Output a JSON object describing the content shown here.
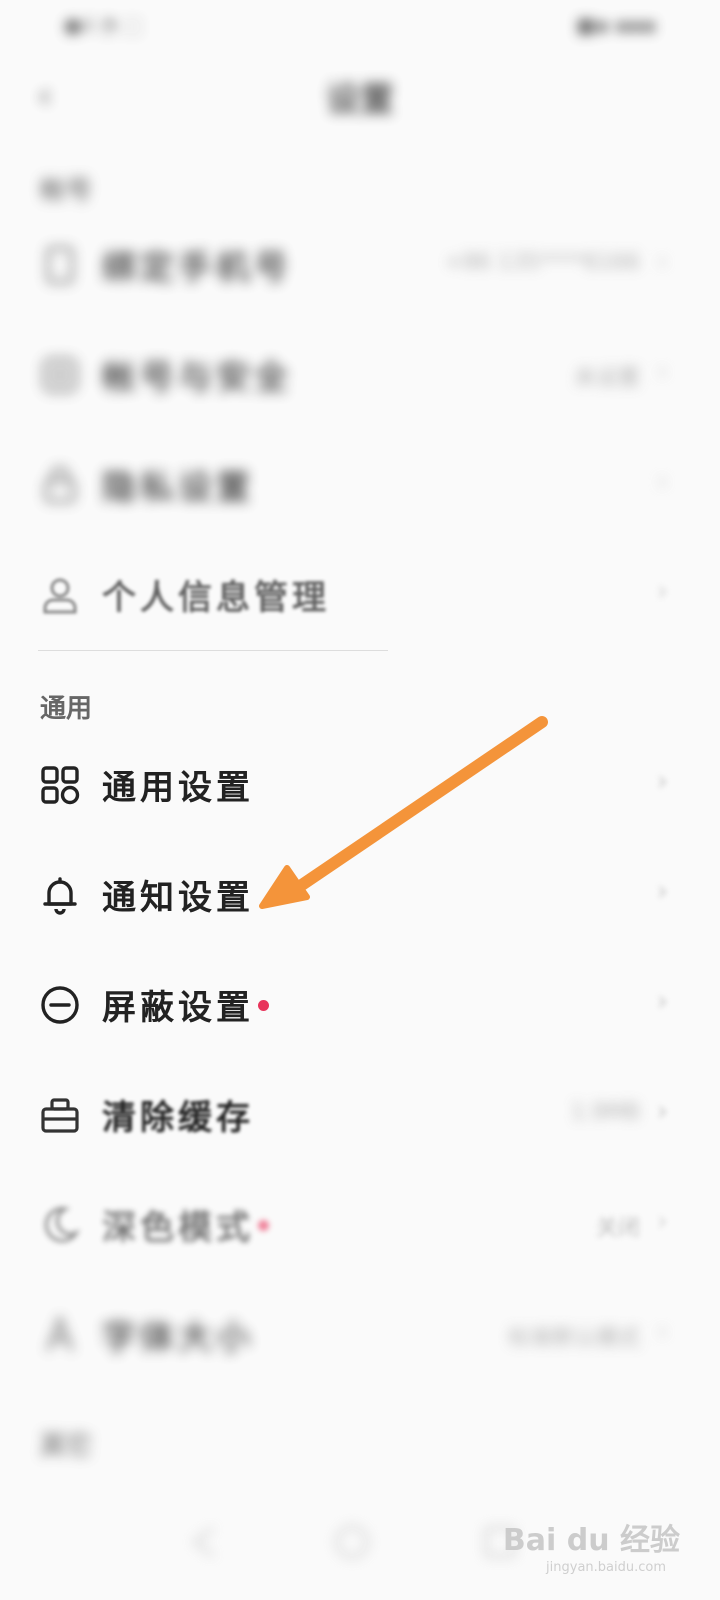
{
  "status_bar": {
    "left": "●ıl ◔ ⬚",
    "right": "■▪ ▪▪▪"
  },
  "nav": {
    "title": "设置"
  },
  "sections": {
    "account": "帐号",
    "general": "通用",
    "other": "其它"
  },
  "account_rows": [
    {
      "label": "绑定手机号",
      "value": "+86 135****6166",
      "icon": "phone-icon"
    },
    {
      "label": "帐号与安全",
      "value": "未设置",
      "icon": "security-icon"
    },
    {
      "label": "隐私设置",
      "value": "",
      "icon": "lock-icon"
    },
    {
      "label": "个人信息管理",
      "value": "",
      "icon": "person-icon"
    }
  ],
  "general_rows": [
    {
      "label": "通用设置",
      "value": "",
      "icon": "grid-icon"
    },
    {
      "label": "通知设置",
      "value": "",
      "icon": "bell-icon"
    },
    {
      "label": "屏蔽设置",
      "value": "",
      "icon": "block-icon",
      "dot": true
    },
    {
      "label": "清除缓存",
      "value": "1.9MB",
      "icon": "box-icon"
    },
    {
      "label": "深色模式",
      "value": "关闭",
      "icon": "moon-icon",
      "dot": true
    },
    {
      "label": "字体大小",
      "value": "标准默认模式",
      "icon": "font-icon"
    }
  ],
  "watermark": {
    "brand": "Bai du 经验",
    "sub": "jingyan.baidu.com"
  },
  "colors": {
    "accent_dot": "#e8345b",
    "arrow": "#f4943a"
  }
}
